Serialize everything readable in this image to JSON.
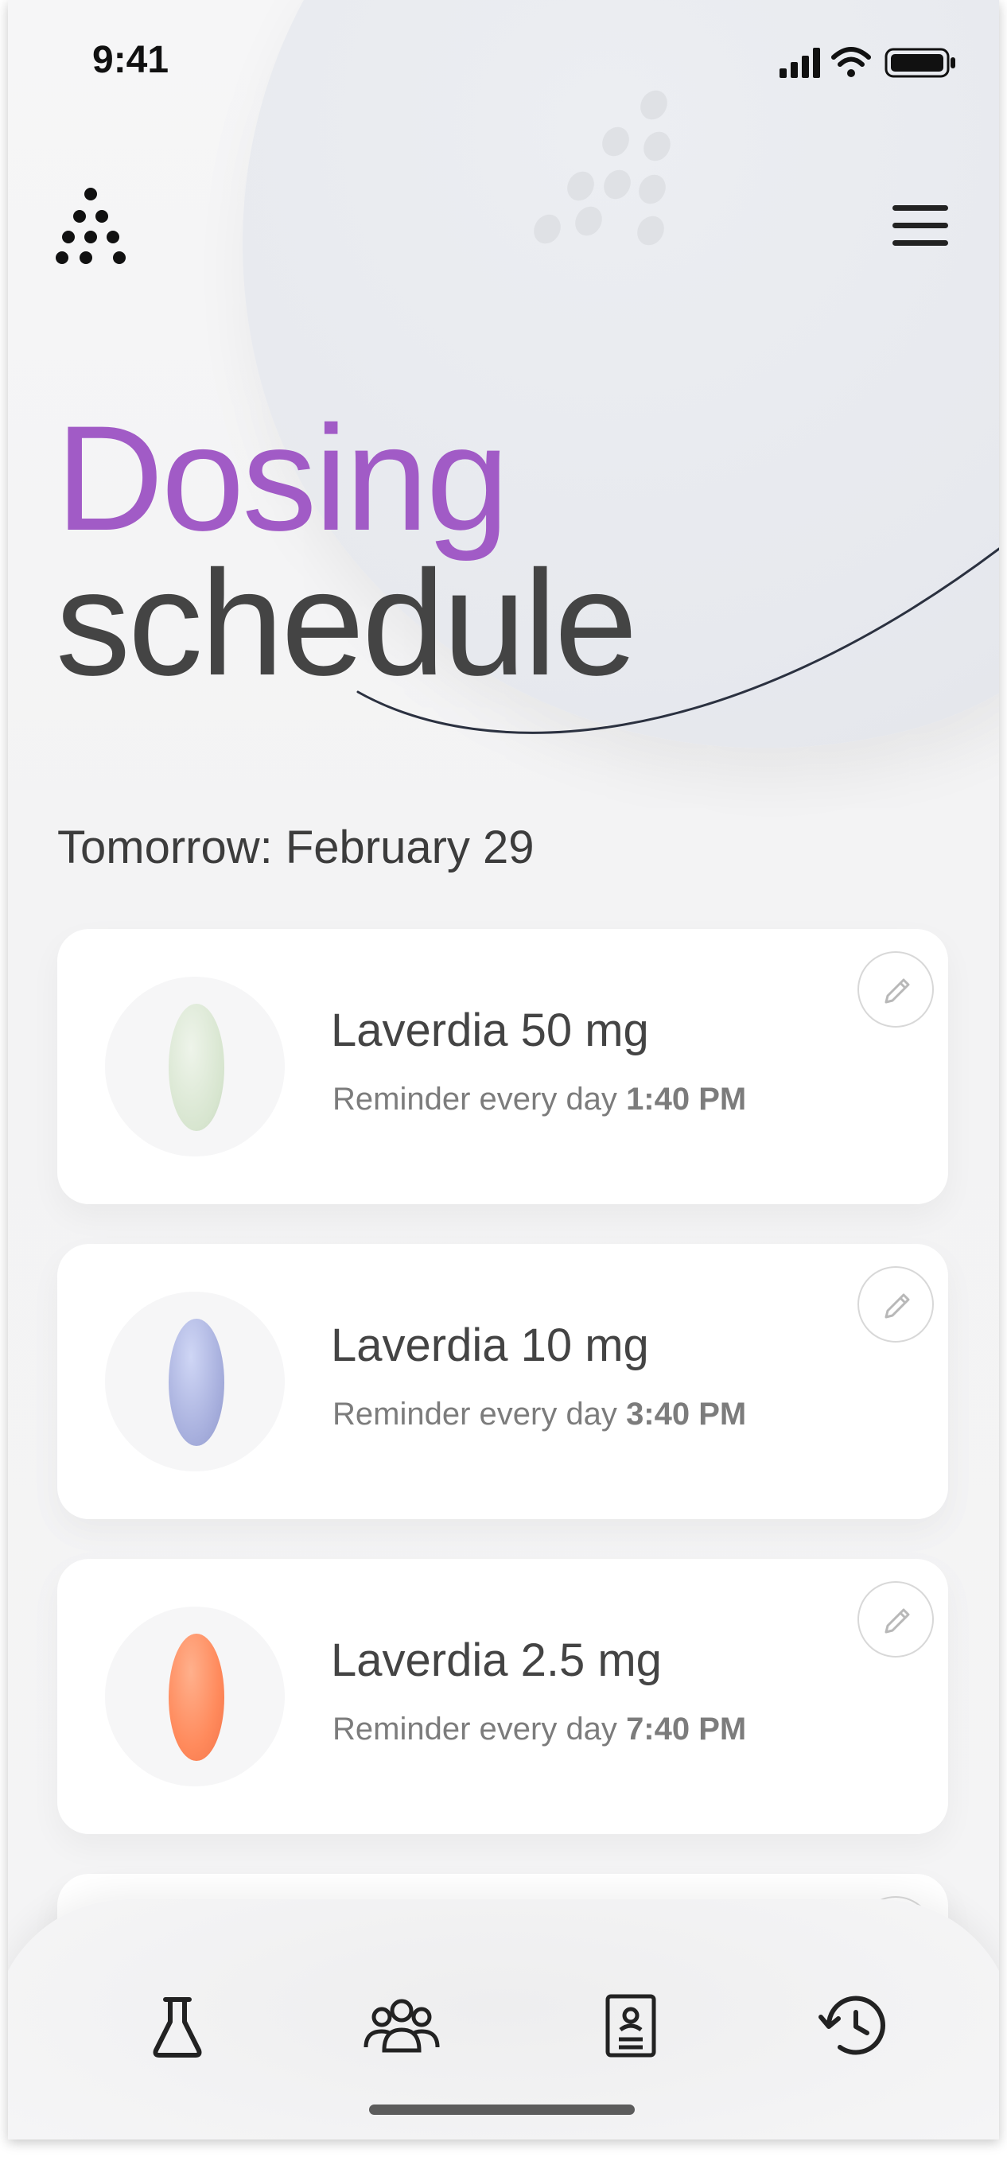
{
  "status_bar": {
    "time": "9:41"
  },
  "header": {
    "logo_icon": "dots-triangle-logo",
    "menu_icon": "hamburger-menu-icon"
  },
  "page": {
    "title_accent": "Dosing",
    "title_rest": "schedule",
    "date_label": "Tomorrow: February 29"
  },
  "colors": {
    "accent": "#a15bc6",
    "title_dark": "#444444",
    "card_bg": "#ffffff"
  },
  "medications": [
    {
      "name": "Laverdia 50 mg",
      "reminder_prefix": "Reminder every day",
      "time": "1:40 PM",
      "pill_color": "#d7e5cf"
    },
    {
      "name": "Laverdia 10 mg",
      "reminder_prefix": "Reminder every day",
      "time": "3:40 PM",
      "pill_color": "#a7afdd"
    },
    {
      "name": "Laverdia 2.5 mg",
      "reminder_prefix": "Reminder every day",
      "time": "7:40 PM",
      "pill_color": "#ff8a5c"
    }
  ],
  "bottom_nav": {
    "items": [
      {
        "icon": "flask-icon"
      },
      {
        "icon": "people-group-icon"
      },
      {
        "icon": "profile-document-icon"
      },
      {
        "icon": "history-clock-icon"
      }
    ]
  }
}
